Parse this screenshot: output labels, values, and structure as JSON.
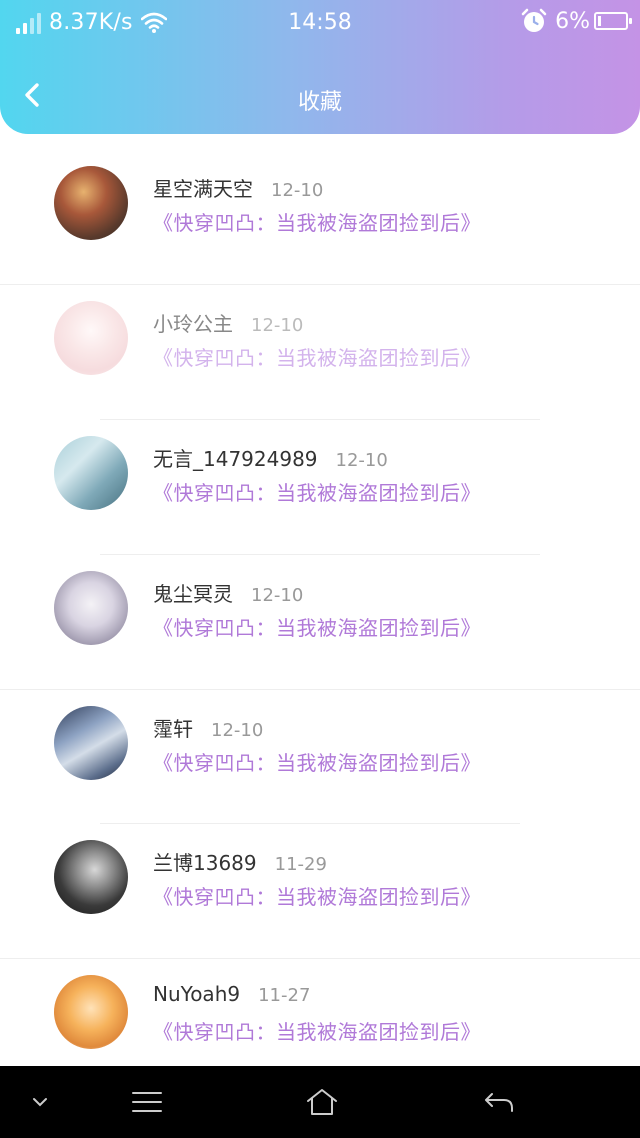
{
  "status_bar": {
    "network_speed": "8.37K/s",
    "time": "14:58",
    "battery": "6%",
    "icons": [
      "signal-icon",
      "wifi-icon",
      "alarm-icon",
      "battery-icon"
    ]
  },
  "header": {
    "title": "收藏",
    "back_icon": "chevron-left-icon"
  },
  "colors": {
    "header_gradient": [
      "#52d6ef",
      "#c493e6"
    ],
    "book_title": "#b079d8",
    "date": "#999999"
  },
  "favorites": [
    {
      "name": "星空满天空",
      "date": "12-10",
      "book": "《快穿凹凸：当我被海盗团捡到后》"
    },
    {
      "name": "小玲公主",
      "date": "12-10",
      "book": "《快穿凹凸：当我被海盗团捡到后》"
    },
    {
      "name": "无言_147924989",
      "date": "12-10",
      "book": "《快穿凹凸：当我被海盗团捡到后》"
    },
    {
      "name": "鬼尘冥灵",
      "date": "12-10",
      "book": "《快穿凹凸：当我被海盗团捡到后》"
    },
    {
      "name": "霪轩",
      "date": "12-10",
      "book": "《快穿凹凸：当我被海盗团捡到后》"
    },
    {
      "name": "兰博13689",
      "date": "11-29",
      "book": "《快穿凹凸：当我被海盗团捡到后》"
    },
    {
      "name": "NuYoah9",
      "date": "11-27",
      "book": "《快穿凹凸：当我被海盗团捡到后》"
    }
  ],
  "nav_bar": {
    "icons": [
      "chevron-down-icon",
      "menu-icon",
      "home-icon",
      "back-arrow-icon"
    ]
  }
}
